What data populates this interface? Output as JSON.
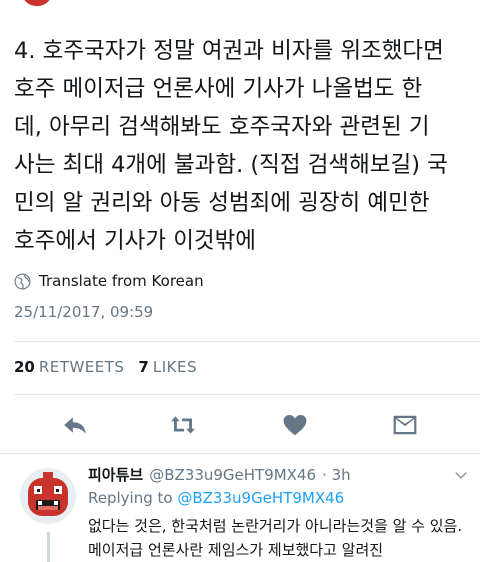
{
  "tweet": {
    "body": "4. 호주국자가 정말 여권과 비자를 위조했다면\n호주 메이저급 언론사에 기사가 나올법도 한\n데, 아무리 검색해봐도 호주국자와 관련된 기\n사는 최대 4개에 불과함. (직접 검색해보길) 국\n민의 알 권리와 아동 성범죄에 굉장히 예민한\n호주에서 기사가 이것밖에",
    "translate_label": "Translate from Korean",
    "timestamp": "25/11/2017, 09:59"
  },
  "stats": {
    "retweets_count": "20",
    "retweets_label": "RETWEETS",
    "likes_count": "7",
    "likes_label": "LIKES"
  },
  "actions": {
    "icons": [
      "reply-icon",
      "retweet-icon",
      "like-icon",
      "direct-message-icon"
    ]
  },
  "reply": {
    "name": "피아튜브",
    "handle": "@BZ33u9GeHT9MX46",
    "time": "· 3h",
    "replying_prefix": "Replying to",
    "replying_handle": "@BZ33u9GeHT9MX46",
    "text": "없다는 것은, 한국처럼 논란거리가 아니라는것을 알 수 있음. 메이저급 언론사란 제임스가 제보했다고 알려진"
  },
  "colors": {
    "link": "#1da1f2",
    "muted": "#657786",
    "text": "#14171a",
    "avatar": "#c8332b"
  }
}
